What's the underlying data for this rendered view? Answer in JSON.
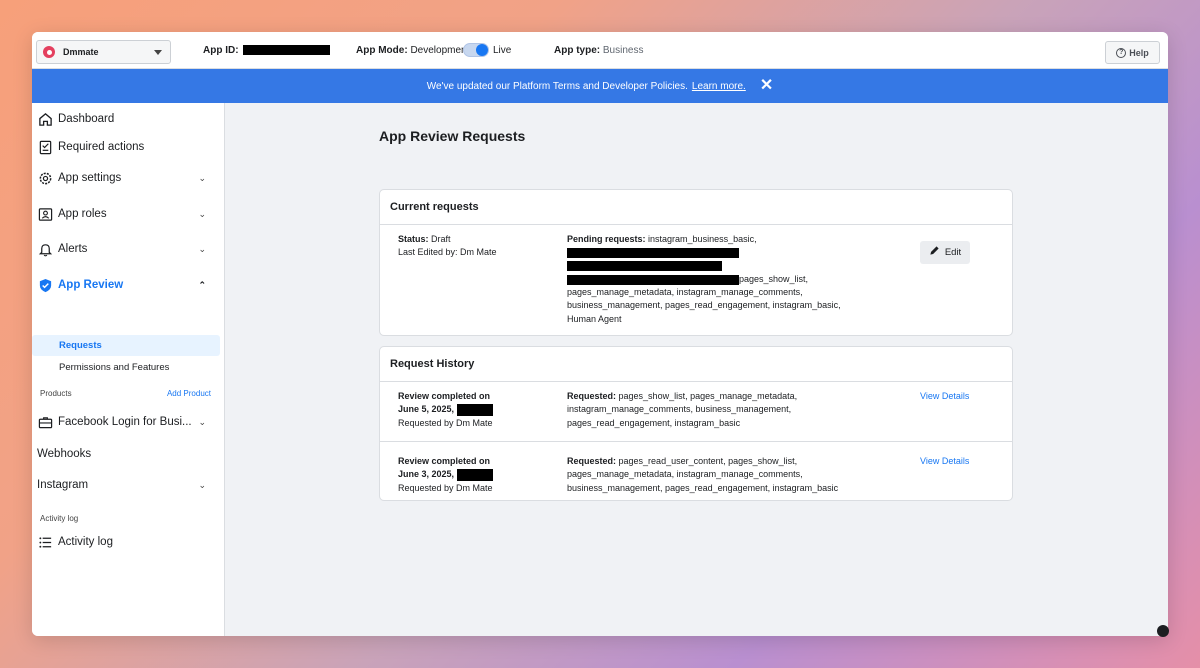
{
  "topbar": {
    "app_name": "Dmmate",
    "app_id_label": "App ID:",
    "app_mode_label": "App Mode:",
    "app_mode_value": "Development",
    "app_mode_live": "Live",
    "app_type_label": "App type:",
    "app_type_value": "Business",
    "help_label": "Help"
  },
  "banner": {
    "text": "We've updated our Platform Terms and Developer Policies.",
    "link": "Learn more."
  },
  "sidebar": {
    "dashboard": "Dashboard",
    "required_actions": "Required actions",
    "app_settings": "App settings",
    "app_roles": "App roles",
    "alerts": "Alerts",
    "app_review": "App Review",
    "requests": "Requests",
    "permissions_features": "Permissions and Features",
    "products_label": "Products",
    "add_product": "Add Product",
    "facebook_login": "Facebook Login for Busi...",
    "webhooks": "Webhooks",
    "instagram": "Instagram",
    "activity_log_label": "Activity log",
    "activity_log": "Activity log"
  },
  "main": {
    "title": "App Review Requests",
    "current": {
      "heading": "Current requests",
      "status_label": "Status:",
      "status_value": "Draft",
      "last_edited": "Last Edited by: Dm Mate",
      "pending_label": "Pending requests:",
      "pending_line1": "instagram_business_basic,",
      "pending_line4": "pages_show_list,",
      "pending_line5": "pages_manage_metadata, instagram_manage_comments,",
      "pending_line6": "business_management, pages_read_engagement, instagram_basic,",
      "pending_line7": "Human Agent",
      "edit_label": "Edit"
    },
    "history": {
      "heading": "Request History",
      "items": [
        {
          "completed": "Review completed on",
          "date": "June 5, 2025,",
          "requested_by": "Requested by Dm Mate",
          "requested_label": "Requested:",
          "line1": "pages_show_list, pages_manage_metadata,",
          "line2": "instagram_manage_comments, business_management,",
          "line3": "pages_read_engagement, instagram_basic",
          "link": "View Details"
        },
        {
          "completed": "Review completed on",
          "date": "June 3, 2025,",
          "requested_by": "Requested by Dm Mate",
          "requested_label": "Requested:",
          "line1": "pages_read_user_content, pages_show_list,",
          "line2": "pages_manage_metadata, instagram_manage_comments,",
          "line3": "business_management, pages_read_engagement, instagram_basic",
          "link": "View Details"
        }
      ]
    }
  },
  "icons": {
    "app_logo": "instagram-logo-icon",
    "help": "help-circle-icon",
    "close": "close-icon",
    "edit": "pencil-icon"
  },
  "colors": {
    "brand_blue": "#1877f2",
    "banner_blue": "#3578e5"
  }
}
